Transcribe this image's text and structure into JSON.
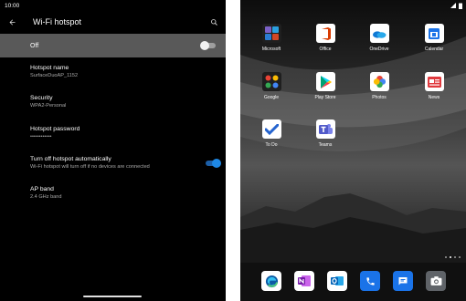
{
  "status_bar": {
    "time": "10:00"
  },
  "header": {
    "title": "Wi-Fi hotspot",
    "back_icon": "arrow-back-icon",
    "search_icon": "search-icon"
  },
  "master_switch": {
    "label": "Off",
    "state": "off"
  },
  "settings": {
    "hotspot_name": {
      "title": "Hotspot name",
      "value": "SurfaceDuoAP_1152"
    },
    "security": {
      "title": "Security",
      "value": "WPA2-Personal"
    },
    "password": {
      "title": "Hotspot password",
      "value": "••••••••••••"
    },
    "auto_off": {
      "title": "Turn off hotspot automatically",
      "summary": "Wi-Fi hotspot will turn off if no devices are connected",
      "state": "on"
    },
    "ap_band": {
      "title": "AP band",
      "value": "2.4 GHz band"
    }
  },
  "home": {
    "apps": [
      {
        "label": "Microsoft",
        "icon": "microsoft-folder-icon"
      },
      {
        "label": "Office",
        "icon": "office-icon"
      },
      {
        "label": "OneDrive",
        "icon": "onedrive-icon"
      },
      {
        "label": "Calendar",
        "icon": "calendar-icon"
      },
      {
        "label": "Google",
        "icon": "google-folder-icon"
      },
      {
        "label": "Play Store",
        "icon": "play-store-icon"
      },
      {
        "label": "Photos",
        "icon": "photos-icon"
      },
      {
        "label": "News",
        "icon": "news-icon"
      },
      {
        "label": "To Do",
        "icon": "todo-icon"
      },
      {
        "label": "Teams",
        "icon": "teams-icon"
      }
    ],
    "dock": [
      "edge-icon",
      "onenote-icon",
      "outlook-icon",
      "phone-icon",
      "messages-icon",
      "camera-icon"
    ],
    "page_indicator": {
      "pages": 4,
      "active": 2
    }
  },
  "colors": {
    "accent": "#1e88e5",
    "office_red": "#d83b01",
    "onedrive_blue": "#0f78d4"
  }
}
